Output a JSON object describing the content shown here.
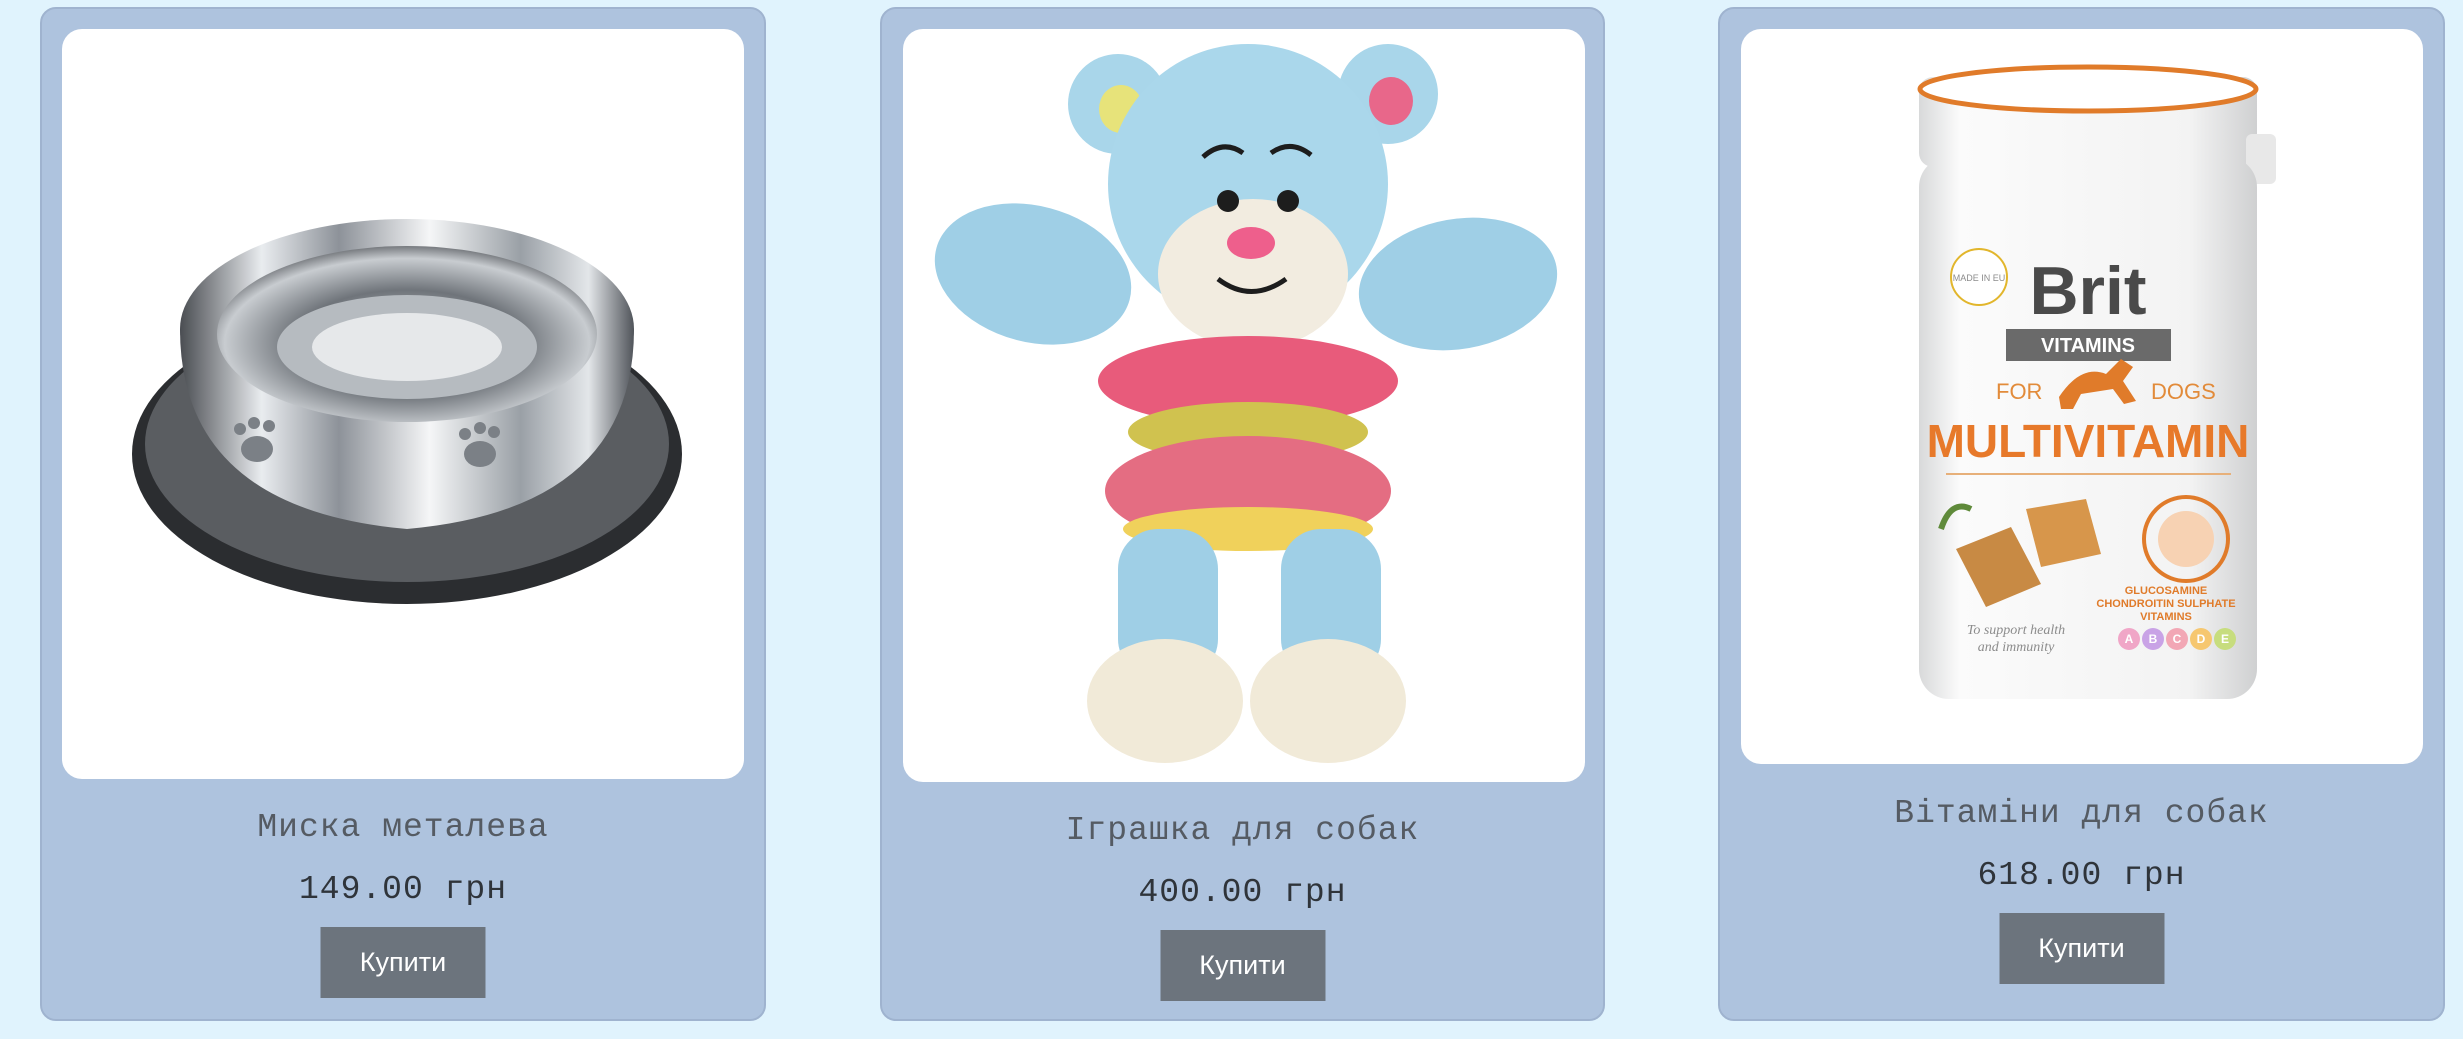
{
  "products": [
    {
      "name": "Миска металева",
      "price": "149.00 грн",
      "buy_label": "Купити",
      "image_icon": "metal-bowl-image"
    },
    {
      "name": "Іграшка для собак",
      "price": "400.00 грн",
      "buy_label": "Купити",
      "image_icon": "plush-bear-toy-image"
    },
    {
      "name": "Вітаміни для собак",
      "price": "618.00 грн",
      "buy_label": "Купити",
      "image_icon": "vitamin-jar-image",
      "label": {
        "brand": "Brit",
        "line": "VITAMINS",
        "made_in": "MADE IN EU",
        "for_dogs_left": "FOR",
        "for_dogs_right": "DOGS",
        "product": "MULTIVITAMIN",
        "ingredients_1": "GLUCOSAMINE",
        "ingredients_2": "CHONDROITIN SULPHATE",
        "ingredients_3": "VITAMINS",
        "tagline_1": "To support health",
        "tagline_2": "and immunity",
        "vitamin_letters": [
          "A",
          "B",
          "C",
          "D",
          "E"
        ]
      }
    }
  ],
  "colors": {
    "page_background": "#e0f3fd",
    "card_background": "#aec3de",
    "button_background": "#6c747d",
    "button_text": "#ffffff"
  }
}
